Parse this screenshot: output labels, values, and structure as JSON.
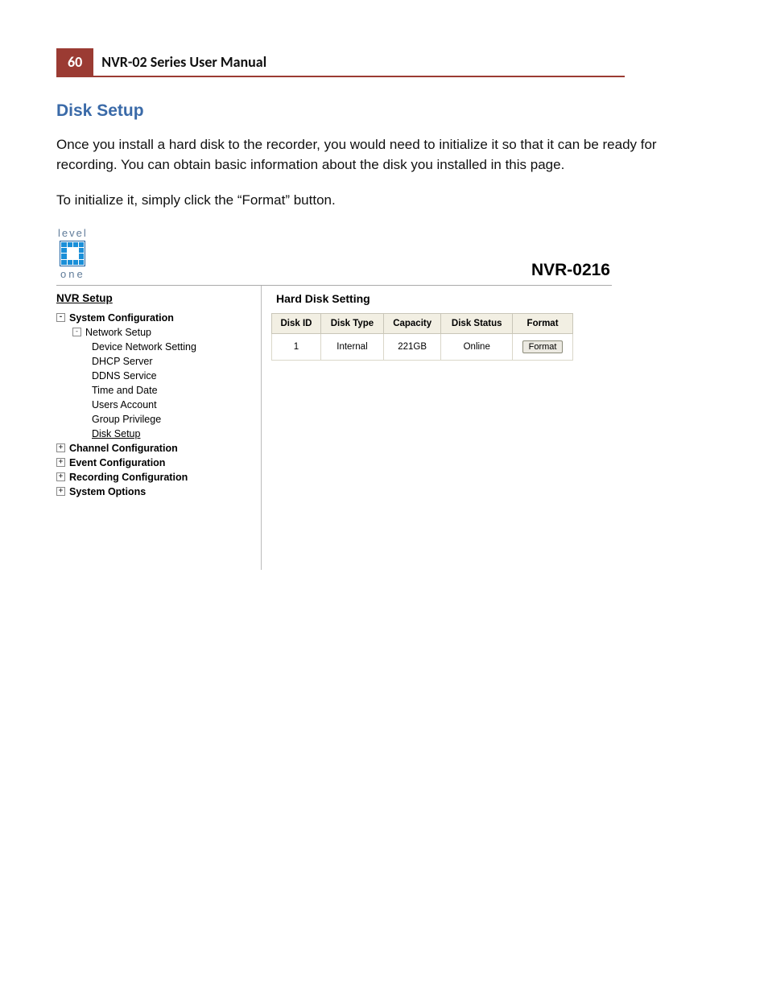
{
  "header": {
    "page_number": "60",
    "manual_title": "NVR-02 Series User Manual"
  },
  "section": {
    "title": "Disk Setup",
    "paragraph1": "Once you install a hard disk to the recorder, you would need to initialize it so that it can be ready for recording. You can obtain basic information about the disk you installed in this page.",
    "paragraph2": "To initialize it, simply click the “Format” button."
  },
  "screenshot": {
    "logo": {
      "top": "level",
      "bottom": "one"
    },
    "model": "NVR-0216",
    "sidebar": {
      "title": "NVR Setup",
      "system_config": "System Configuration",
      "network_setup": "Network Setup",
      "children": {
        "device_network": "Device Network Setting",
        "dhcp": "DHCP Server",
        "ddns": "DDNS Service",
        "time_date": "Time and Date",
        "users": "Users Account",
        "group": "Group Privilege",
        "disk_setup": "Disk Setup"
      },
      "channel_config": "Channel Configuration",
      "event_config": "Event Configuration",
      "recording_config": "Recording Configuration",
      "system_options": "System Options"
    },
    "pane": {
      "title": "Hard Disk Setting",
      "columns": {
        "disk_id": "Disk ID",
        "disk_type": "Disk Type",
        "capacity": "Capacity",
        "disk_status": "Disk Status",
        "format": "Format"
      },
      "row": {
        "disk_id": "1",
        "disk_type": "Internal",
        "capacity": "221GB",
        "disk_status": "Online",
        "format_btn": "Format"
      }
    }
  }
}
